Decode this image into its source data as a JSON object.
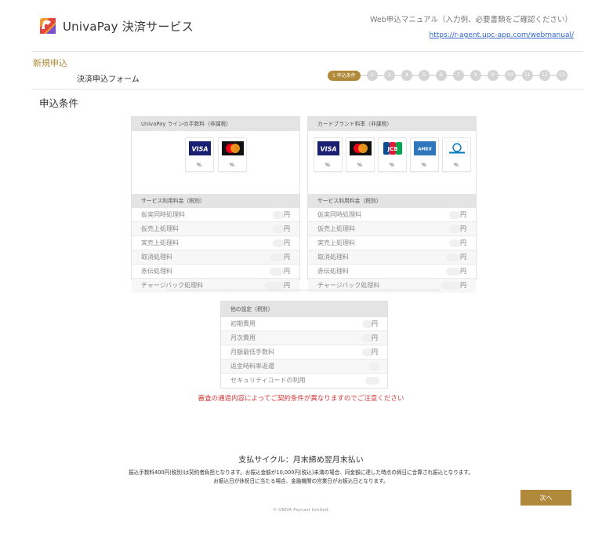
{
  "header": {
    "logo_text": "UnivaPay 決済サービス",
    "manual_title": "Web申込マニュアル（入力例、必要書類をご確認ください）",
    "manual_link": "https://r-agent.upc-app.com/webmanual/"
  },
  "section_title": "新規申込",
  "form_name": "決済申込フォーム",
  "steps": {
    "active_label": "1 申込条件",
    "others": [
      "2",
      "3",
      "4",
      "5",
      "6",
      "7",
      "8",
      "9",
      "10",
      "11",
      "12",
      "13"
    ]
  },
  "conditions_title": "申込条件",
  "panel_left": {
    "title": "UnivaPay ラインの手数料（非課税）",
    "cards": [
      {
        "icon": "visa-icon",
        "percent": "%"
      },
      {
        "icon": "mastercard-icon",
        "percent": "%"
      }
    ],
    "fees_title": "サービス利用料金（税別）",
    "fees": [
      {
        "label": "仮実同時処理料",
        "unit": "円"
      },
      {
        "label": "仮売上処理料",
        "unit": "円"
      },
      {
        "label": "実売上処理料",
        "unit": "円"
      },
      {
        "label": "取消処理料",
        "unit": "円"
      },
      {
        "label": "赤伝処理料",
        "unit": "円"
      },
      {
        "label": "チャージバック処理料",
        "unit": "円"
      }
    ]
  },
  "panel_right": {
    "title": "カードブランド料率（非課税）",
    "cards": [
      {
        "icon": "visa-icon",
        "percent": "%"
      },
      {
        "icon": "mastercard-icon",
        "percent": "%"
      },
      {
        "icon": "jcb-icon",
        "percent": "%"
      },
      {
        "icon": "amex-icon",
        "percent": "%"
      },
      {
        "icon": "diners-club-icon",
        "percent": "%"
      }
    ],
    "fees_title": "サービス利用料金（税別）",
    "fees": [
      {
        "label": "仮実同時処理料",
        "unit": "円"
      },
      {
        "label": "仮売上処理料",
        "unit": "円"
      },
      {
        "label": "実売上処理料",
        "unit": "円"
      },
      {
        "label": "取消処理料",
        "unit": "円"
      },
      {
        "label": "赤伝処理料",
        "unit": "円"
      },
      {
        "label": "チャージバック処理料",
        "unit": "円"
      }
    ]
  },
  "panel_other": {
    "title": "他の設定（税別）",
    "rows": [
      {
        "label": "初期費用",
        "unit": "円"
      },
      {
        "label": "月次費用",
        "unit": "円"
      },
      {
        "label": "月額最低手数料",
        "unit": "円"
      },
      {
        "label": "返金時料率返還",
        "unit": ""
      },
      {
        "label": "セキュリティコードの利用",
        "unit": ""
      }
    ]
  },
  "notice": "審査の通過内容によってご契約条件が異なりますのでご注意ください",
  "payment_cycle": "支払サイクル：月末締め翌月末払い",
  "fine_print_1": "振込手数料400円(税別)は契約者負担となります。お振込金額が10,000円(税込)未満の場合、同金額に達した時点の締日に合算され振込となります。",
  "fine_print_2": "お振込日が休祝日に当たる場合、金融機関の営業日がお振込日となります。",
  "next_button": "次へ",
  "copyright": "© UNIVA Paycast Limited.",
  "colors": {
    "accent": "#b08a3a",
    "link": "#3366cc",
    "notice": "#d23a3a"
  }
}
